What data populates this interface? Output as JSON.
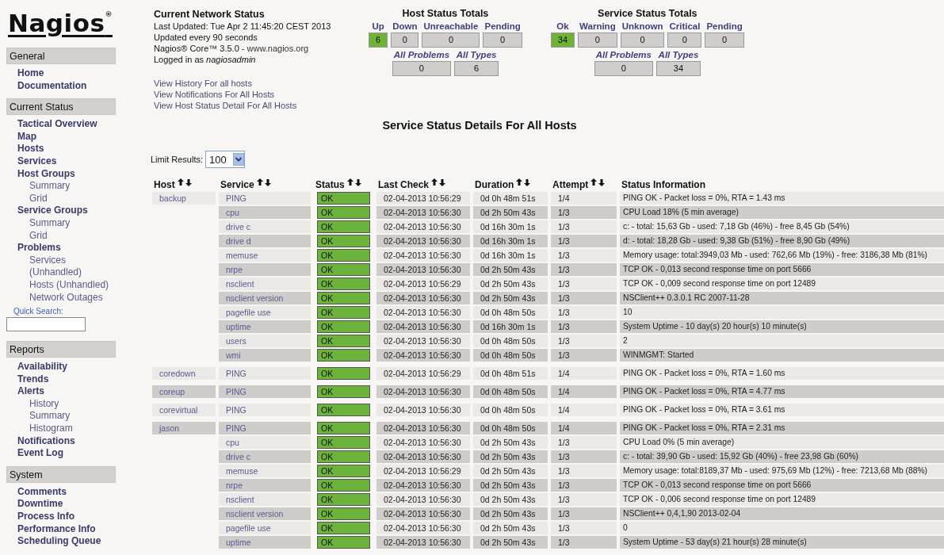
{
  "logo": {
    "text": "Nagios$^{®}$"
  },
  "sidebar": [
    {
      "title": "General",
      "items": [
        {
          "label": "Home"
        },
        {
          "label": "Documentation"
        }
      ]
    },
    {
      "title": "Current Status",
      "items": [
        {
          "label": "Tactical Overview"
        },
        {
          "label": "Map"
        },
        {
          "label": "Hosts"
        },
        {
          "label": "Services"
        },
        {
          "label": "Host Groups",
          "children": [
            {
              "label": "Summary"
            },
            {
              "label": "Grid"
            }
          ]
        },
        {
          "label": "Service Groups",
          "children": [
            {
              "label": "Summary"
            },
            {
              "label": "Grid"
            }
          ]
        },
        {
          "label": "Problems",
          "children": [
            {
              "label": "Services (Unhandled)"
            },
            {
              "label": "Hosts (Unhandled)"
            },
            {
              "label": "Network Outages"
            }
          ]
        }
      ],
      "quick_search": {
        "label": "Quick Search:"
      }
    },
    {
      "title": "Reports",
      "items": [
        {
          "label": "Availability"
        },
        {
          "label": "Trends"
        },
        {
          "label": "Alerts",
          "children": [
            {
              "label": "History"
            },
            {
              "label": "Summary"
            },
            {
              "label": "Histogram"
            }
          ]
        },
        {
          "label": "Notifications"
        },
        {
          "label": "Event Log"
        }
      ]
    },
    {
      "title": "System",
      "items": [
        {
          "label": "Comments"
        },
        {
          "label": "Downtime"
        },
        {
          "label": "Process Info"
        },
        {
          "label": "Performance Info"
        },
        {
          "label": "Scheduling Queue"
        }
      ]
    }
  ],
  "status_info": {
    "title": "Current Network Status",
    "lines": [
      "Last Updated: Tue Apr 2 11:45:20 CEST 2013",
      "Updated every 90 seconds"
    ],
    "version": "Nagios® Core™ 3.5.0 - ",
    "version_link": "www.nagios.org",
    "logged_in": "Logged in as *nagiosadmin*",
    "links": [
      "View History For all hosts",
      "View Notifications For All Hosts",
      "View Host Status Detail For All Hosts"
    ]
  },
  "host_totals": {
    "title": "Host Status Totals",
    "counts": [
      {
        "label": "Up",
        "value": "6",
        "highlight": true
      },
      {
        "label": "Down",
        "value": "0",
        "highlight": false
      },
      {
        "label": "Unreachable",
        "value": "0",
        "highlight": false
      },
      {
        "label": "Pending",
        "value": "0",
        "highlight": false
      }
    ],
    "summary": [
      {
        "label": "All Problems",
        "value": "0"
      },
      {
        "label": "All Types",
        "value": "6"
      }
    ]
  },
  "service_totals": {
    "title": "Service Status Totals",
    "counts": [
      {
        "label": "Ok",
        "value": "34",
        "highlight": true
      },
      {
        "label": "Warning",
        "value": "0",
        "highlight": false
      },
      {
        "label": "Unknown",
        "value": "0",
        "highlight": false
      },
      {
        "label": "Critical",
        "value": "0",
        "highlight": false
      },
      {
        "label": "Pending",
        "value": "0",
        "highlight": false
      }
    ],
    "summary": [
      {
        "label": "All Problems",
        "value": "0"
      },
      {
        "label": "All Types",
        "value": "34"
      }
    ]
  },
  "page_title": "Service Status Details For All Hosts",
  "limit": {
    "label": "Limit Results:",
    "value": "100"
  },
  "table": {
    "columns": [
      "Host",
      "Service",
      "Status",
      "Last Check",
      "Duration",
      "Attempt",
      "Status Information"
    ],
    "hosts": [
      {
        "name": "backup",
        "services": [
          {
            "service": "PING",
            "status": "OK",
            "last_check": "02-04-2013 10:56:29",
            "duration": "0d 0h 48m 51s",
            "attempt": "1/4",
            "info": "PING OK - Packet loss = 0%, RTA = 1.43 ms"
          },
          {
            "service": "cpu",
            "status": "OK",
            "last_check": "02-04-2013 10:56:30",
            "duration": "0d 2h 50m 43s",
            "attempt": "1/3",
            "info": "CPU Load 18% (5 min average)"
          },
          {
            "service": "drive c",
            "status": "OK",
            "last_check": "02-04-2013 10:56:30",
            "duration": "0d 16h 30m 1s",
            "attempt": "1/3",
            "info": "c: - total: 15,63 Gb - used: 7,18 Gb (46%) - free 8,45 Gb (54%)"
          },
          {
            "service": "drive d",
            "status": "OK",
            "last_check": "02-04-2013 10:56:30",
            "duration": "0d 16h 30m 1s",
            "attempt": "1/3",
            "info": "d: - total: 18,28 Gb - used: 9,38 Gb (51%) - free 8,90 Gb (49%)"
          },
          {
            "service": "memuse",
            "status": "OK",
            "last_check": "02-04-2013 10:56:30",
            "duration": "0d 16h 30m 1s",
            "attempt": "1/3",
            "info": "Memory usage: total:3949,03 Mb - used: 762,66 Mb (19%) - free: 3186,38 Mb (81%)"
          },
          {
            "service": "nrpe",
            "status": "OK",
            "last_check": "02-04-2013 10:56:30",
            "duration": "0d 2h 50m 43s",
            "attempt": "1/3",
            "info": "TCP OK - 0,013 second response time on port 5666"
          },
          {
            "service": "nsclient",
            "status": "OK",
            "last_check": "02-04-2013 10:56:29",
            "duration": "0d 2h 50m 43s",
            "attempt": "1/3",
            "info": "TCP OK - 0,009 second response time on port 12489"
          },
          {
            "service": "nsclient version",
            "status": "OK",
            "last_check": "02-04-2013 10:56:30",
            "duration": "0d 2h 50m 43s",
            "attempt": "1/3",
            "info": "NSClient++ 0.3.0.1 RC 2007-11-28"
          },
          {
            "service": "pagefile use",
            "status": "OK",
            "last_check": "02-04-2013 10:56:30",
            "duration": "0d 0h 48m 50s",
            "attempt": "1/3",
            "info": "10"
          },
          {
            "service": "uptime",
            "status": "OK",
            "last_check": "02-04-2013 10:56:30",
            "duration": "0d 16h 30m 1s",
            "attempt": "1/3",
            "info": "System Uptime - 10 day(s) 20 hour(s) 10 minute(s)"
          },
          {
            "service": "users",
            "status": "OK",
            "last_check": "02-04-2013 10:56:30",
            "duration": "0d 0h 48m 50s",
            "attempt": "1/3",
            "info": "2"
          },
          {
            "service": "wmi",
            "status": "OK",
            "last_check": "02-04-2013 10:56:30",
            "duration": "0d 0h 48m 50s",
            "attempt": "1/3",
            "info": "WINMGMT: Started"
          }
        ]
      },
      {
        "name": "coredown",
        "services": [
          {
            "service": "PING",
            "status": "OK",
            "last_check": "02-04-2013 10:56:29",
            "duration": "0d 0h 48m 51s",
            "attempt": "1/4",
            "info": "PING OK - Packet loss = 0%, RTA = 1.60 ms"
          }
        ]
      },
      {
        "name": "coreup",
        "services": [
          {
            "service": "PING",
            "status": "OK",
            "last_check": "02-04-2013 10:56:30",
            "duration": "0d 0h 48m 50s",
            "attempt": "1/4",
            "info": "PING OK - Packet loss = 0%, RTA = 4.77 ms"
          }
        ]
      },
      {
        "name": "corevirtual",
        "services": [
          {
            "service": "PING",
            "status": "OK",
            "last_check": "02-04-2013 10:56:30",
            "duration": "0d 0h 48m 50s",
            "attempt": "1/4",
            "info": "PING OK - Packet loss = 0%, RTA = 3.61 ms"
          }
        ]
      },
      {
        "name": "jason",
        "services": [
          {
            "service": "PING",
            "status": "OK",
            "last_check": "02-04-2013 10:56:30",
            "duration": "0d 0h 48m 50s",
            "attempt": "1/4",
            "info": "PING OK - Packet loss = 0%, RTA = 2.31 ms"
          },
          {
            "service": "cpu",
            "status": "OK",
            "last_check": "02-04-2013 10:56:30",
            "duration": "0d 2h 50m 43s",
            "attempt": "1/3",
            "info": "CPU Load 0% (5 min average)"
          },
          {
            "service": "drive c",
            "status": "OK",
            "last_check": "02-04-2013 10:56:30",
            "duration": "0d 2h 50m 43s",
            "attempt": "1/3",
            "info": "c: - total: 39,90 Gb - used: 15,92 Gb (40%) - free 23,98 Gb (60%)"
          },
          {
            "service": "memuse",
            "status": "OK",
            "last_check": "02-04-2013 10:56:29",
            "duration": "0d 2h 50m 43s",
            "attempt": "1/3",
            "info": "Memory usage: total:8189,37 Mb - used: 975,69 Mb (12%) - free: 7213,68 Mb (88%)"
          },
          {
            "service": "nrpe",
            "status": "OK",
            "last_check": "02-04-2013 10:56:30",
            "duration": "0d 2h 50m 43s",
            "attempt": "1/3",
            "info": "TCP OK - 0,013 second response time on port 5666"
          },
          {
            "service": "nsclient",
            "status": "OK",
            "last_check": "02-04-2013 10:56:30",
            "duration": "0d 2h 50m 43s",
            "attempt": "1/3",
            "info": "TCP OK - 0,006 second response time on port 12489"
          },
          {
            "service": "nsclient version",
            "status": "OK",
            "last_check": "02-04-2013 10:56:30",
            "duration": "0d 2h 50m 43s",
            "attempt": "1/3",
            "info": "NSClient++ 0,4,1,90 2013-02-04"
          },
          {
            "service": "pagefile use",
            "status": "OK",
            "last_check": "02-04-2013 10:56:30",
            "duration": "0d 2h 50m 43s",
            "attempt": "1/3",
            "info": "0"
          },
          {
            "service": "uptime",
            "status": "OK",
            "last_check": "02-04-2013 10:56:30",
            "duration": "0d 2h 50m 43s",
            "attempt": "1/3",
            "info": "System Uptime - 53 day(s) 21 hour(s) 28 minute(s)"
          }
        ]
      }
    ]
  }
}
